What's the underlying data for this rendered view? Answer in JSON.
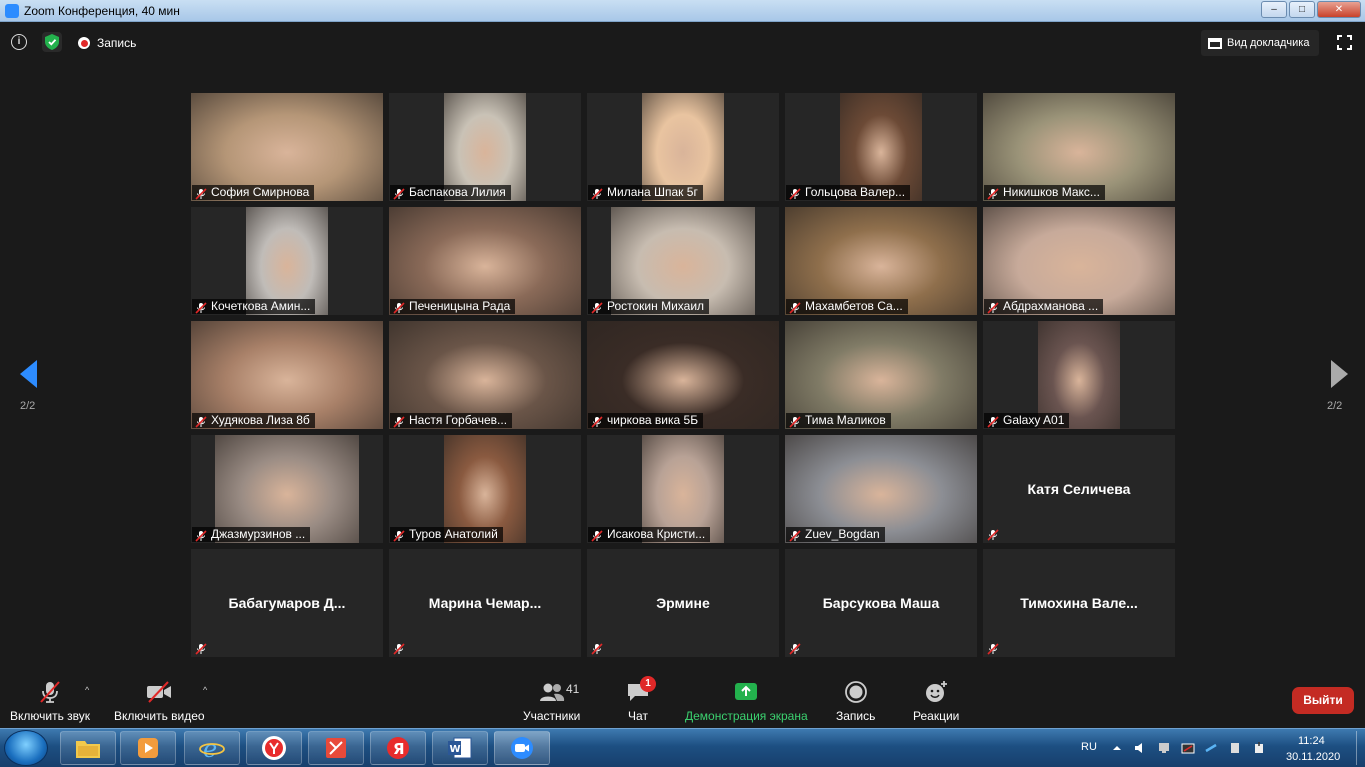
{
  "window": {
    "title": "Zoom Конференция, 40 мин",
    "minimize": "–",
    "maximize": "□",
    "close": "✕"
  },
  "topbar": {
    "info": "i",
    "recording_label": "Запись",
    "speaker_view_label": "Вид докладчика"
  },
  "participants_tiles": [
    {
      "name": "София Смирнова",
      "video": true,
      "muted": true,
      "bg": "#b59677"
    },
    {
      "name": "Баспакова Лилия",
      "video": true,
      "muted": true,
      "bg": "#c9c2b6"
    },
    {
      "name": "Милана Шпак 5г",
      "video": true,
      "muted": true,
      "bg": "#e9c4a0"
    },
    {
      "name": "Гольцова Валер...",
      "video": true,
      "muted": true,
      "bg": "#6c4a36"
    },
    {
      "name": "Никишков Макс...",
      "video": true,
      "muted": true,
      "bg": "#9a9378"
    },
    {
      "name": "Кочеткова Амин...",
      "video": true,
      "muted": true,
      "bg": "#c0bcb8"
    },
    {
      "name": "Печеницына Рада",
      "video": true,
      "muted": true,
      "bg": "#8a6a58"
    },
    {
      "name": "Ростокин Михаил",
      "video": true,
      "muted": true,
      "bg": "#c7bcb0"
    },
    {
      "name": "Махамбетов Са...",
      "video": true,
      "muted": true,
      "bg": "#8f6f4c"
    },
    {
      "name": "Абдрахманова ...",
      "video": true,
      "muted": true,
      "bg": "#c7aa9a"
    },
    {
      "name": "Худякова Лиза 8б",
      "video": true,
      "muted": true,
      "bg": "#a88068"
    },
    {
      "name": "Настя Горбачев...",
      "video": true,
      "muted": true,
      "bg": "#6a5548"
    },
    {
      "name": "чиркова вика 5Б",
      "video": true,
      "muted": true,
      "bg": "#3a2c26"
    },
    {
      "name": "Тима Маликов",
      "video": true,
      "muted": true,
      "bg": "#807b66"
    },
    {
      "name": "Galaxy A01",
      "video": true,
      "muted": true,
      "bg": "#6a5450"
    },
    {
      "name": "Джазмурзинов ...",
      "video": true,
      "muted": true,
      "bg": "#9a8c84"
    },
    {
      "name": "Туров Анатолий",
      "video": true,
      "muted": true,
      "bg": "#8a5a40"
    },
    {
      "name": "Исакова Кристи...",
      "video": true,
      "muted": true,
      "bg": "#b8a296"
    },
    {
      "name": "Zuev_Bogdan",
      "video": true,
      "muted": true,
      "bg": "#8c8e94"
    },
    {
      "name": "Катя Селичева",
      "video": false,
      "muted": true,
      "bg": "#262626"
    },
    {
      "name": "Бабагумаров Д...",
      "video": false,
      "muted": true,
      "bg": "#262626"
    },
    {
      "name": "Марина  Чемар...",
      "video": false,
      "muted": true,
      "bg": "#262626"
    },
    {
      "name": "Эрмине",
      "video": false,
      "muted": true,
      "bg": "#262626"
    },
    {
      "name": "Барсукова Маша",
      "video": false,
      "muted": true,
      "bg": "#262626"
    },
    {
      "name": "Тимохина  Вале...",
      "video": false,
      "muted": true,
      "bg": "#262626"
    }
  ],
  "navigation": {
    "left_page": "2/2",
    "right_page": "2/2"
  },
  "toolbar": {
    "unmute_label": "Включить звук",
    "start_video_label": "Включить видео",
    "participants_label": "Участники",
    "participants_count": "41",
    "chat_label": "Чат",
    "chat_badge": "1",
    "share_label": "Демонстрация экрана",
    "record_label": "Запись",
    "reactions_label": "Реакции",
    "leave_label": "Выйти"
  },
  "taskbar": {
    "language": "RU",
    "time": "11:24",
    "date": "30.11.2020"
  },
  "colors": {
    "zoom_blue": "#2d8cff",
    "share_green": "#3bd16f",
    "leave_red": "#c42b23",
    "badge_red": "#e02828",
    "mute_red": "#e02828"
  }
}
